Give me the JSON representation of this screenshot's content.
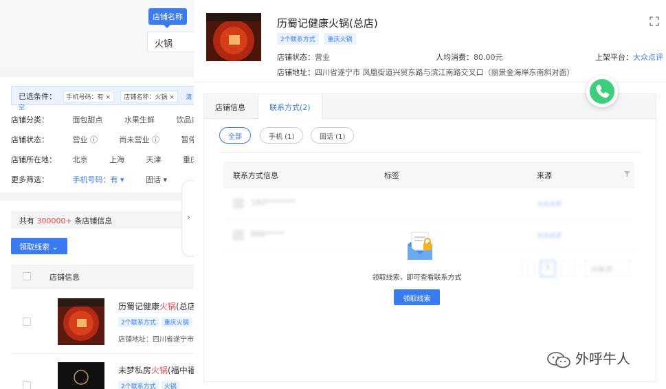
{
  "search": {
    "tooltip": "店铺名称",
    "value": "火锅"
  },
  "filters": {
    "selected_label": "已选条件：",
    "selected_tags": [
      "手机号码：有",
      "店铺名称：火锅"
    ],
    "clear_label": "清空",
    "rows": [
      {
        "label": "店铺分类：",
        "options": [
          "面包甜点",
          "水果生鲜",
          "饮品店"
        ]
      },
      {
        "label": "店铺状态：",
        "options": [
          "营业 ⓘ",
          "尚未营业 ⓘ",
          "暂停营"
        ]
      },
      {
        "label": "店铺所在地：",
        "options": [
          "北京",
          "上海",
          "天津",
          "重庆"
        ]
      },
      {
        "label": "更多筛选：",
        "options": [
          "手机号码：有 ▾",
          "固话 ▾"
        ]
      }
    ]
  },
  "list": {
    "total_prefix": "共有",
    "total_count": "300000+",
    "total_suffix": "条店铺信息",
    "get_leads_label": "领取线索 ⌄",
    "header_shop": "店铺信息",
    "rows": [
      {
        "name_pre": "历蜀记健康",
        "name_hl": "火锅",
        "name_post": "(总店",
        "tags": [
          "2个联系方式",
          "重庆火锅"
        ],
        "addr": "店铺地址：四川省遂宁市"
      },
      {
        "name_pre": "未梦私房",
        "name_hl": "火锅",
        "name_post": "(福中福",
        "tags": [
          "2个联系方式",
          "火锅"
        ],
        "addr": ""
      }
    ]
  },
  "detail": {
    "title": "历蜀记健康火锅(总店)",
    "tags": [
      "2个联系方式",
      "重庆火锅"
    ],
    "status_label": "店铺状态：",
    "status_value": "营业",
    "avg_label": "人均消费：",
    "avg_value": "80.00元",
    "platform_label": "上架平台：",
    "platform_value": "大众点评",
    "address_label": "店铺地址：",
    "address_value": "四川省遂宁市 凤凰街道兴贸东路与滨江南路交叉口（丽景金海岸东南斜对面）",
    "tabs": [
      "店铺信息",
      "联系方式(2)"
    ],
    "pills": [
      "全部",
      "手机 (1)",
      "固话 (1)"
    ],
    "columns": [
      "联系方式信息",
      "标签",
      "来源"
    ],
    "contacts": [
      {
        "number": "180********",
        "source": "大众点评"
      },
      {
        "number": "866*****",
        "source": "大众点评"
      }
    ],
    "pager_size": "20条/页",
    "pager_page": "1",
    "empty_text": "领取线索，即可查看联系方式",
    "reveal_button": "领取线索"
  },
  "watermark": "外呼牛人",
  "colors": {
    "accent": "#3b7bf0",
    "highlight": "#e54545",
    "phone_green": "#3fcf7c"
  }
}
